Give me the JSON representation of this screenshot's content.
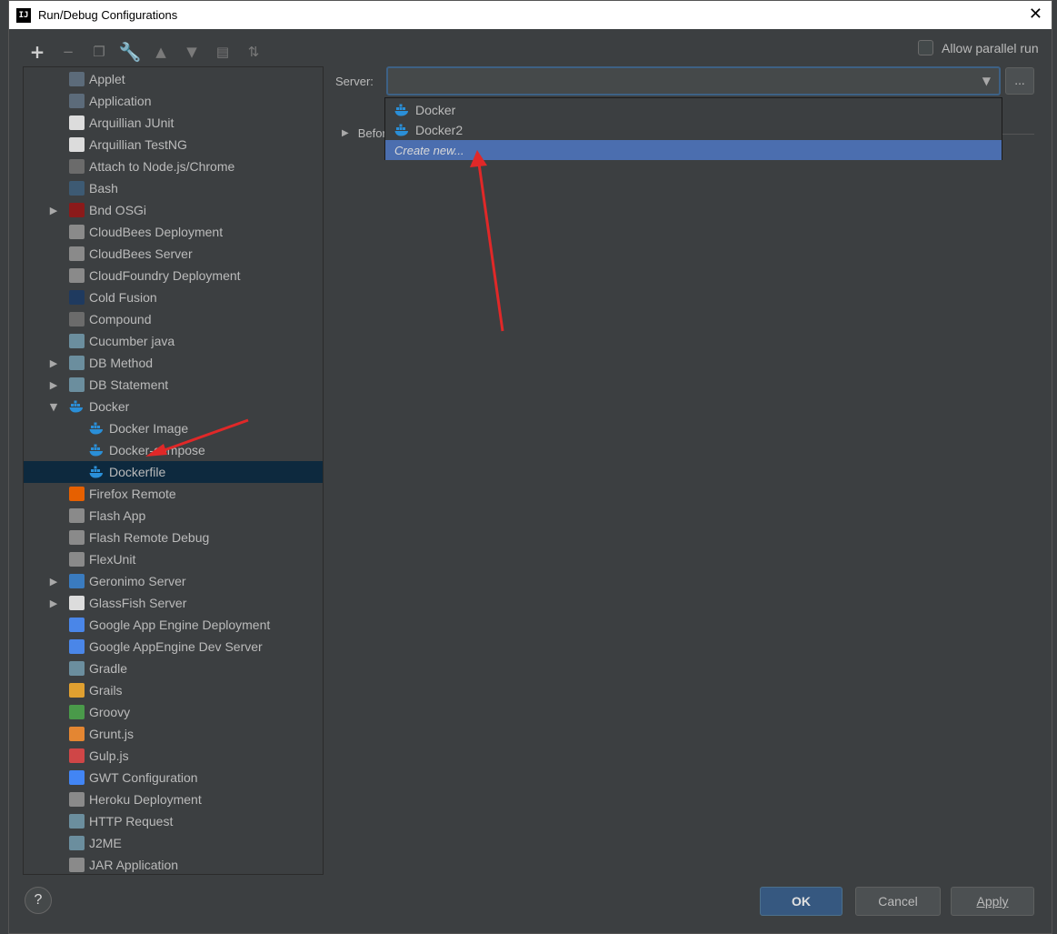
{
  "window": {
    "title": "Run/Debug Configurations",
    "app_icon": "IJ"
  },
  "toolbar": {
    "buttons": [
      {
        "name": "add-icon",
        "glyph": "+",
        "enabled": true
      },
      {
        "name": "remove-icon",
        "glyph": "−",
        "enabled": false
      },
      {
        "name": "copy-icon",
        "glyph": "❐",
        "enabled": false
      },
      {
        "name": "wrench-icon",
        "glyph": "🔧",
        "enabled": true
      },
      {
        "name": "move-up-icon",
        "glyph": "▲",
        "enabled": false
      },
      {
        "name": "move-down-icon",
        "glyph": "▼",
        "enabled": false
      },
      {
        "name": "folder-icon",
        "glyph": "▤",
        "enabled": false
      },
      {
        "name": "sort-icon",
        "glyph": "⇅",
        "enabled": false
      }
    ]
  },
  "allow_parallel": {
    "label": "Allow parallel run",
    "checked": false
  },
  "tree": {
    "items": [
      {
        "label": "Applet",
        "icon": "applet-icon",
        "icon_color": "#5c6b7a",
        "indent": 0,
        "expander": ""
      },
      {
        "label": "Application",
        "icon": "application-icon",
        "icon_color": "#5c6b7a",
        "indent": 0,
        "expander": ""
      },
      {
        "label": "Arquillian JUnit",
        "icon": "arquillian-icon",
        "icon_color": "#dcdcdc",
        "indent": 0,
        "expander": ""
      },
      {
        "label": "Arquillian TestNG",
        "icon": "arquillian-icon",
        "icon_color": "#dcdcdc",
        "indent": 0,
        "expander": ""
      },
      {
        "label": "Attach to Node.js/Chrome",
        "icon": "nodejs-icon",
        "icon_color": "#6b6b6b",
        "indent": 0,
        "expander": ""
      },
      {
        "label": "Bash",
        "icon": "bash-icon",
        "icon_color": "#3d5a73",
        "indent": 0,
        "expander": ""
      },
      {
        "label": "Bnd OSGi",
        "icon": "osgi-icon",
        "icon_color": "#8b1a1a",
        "indent": 0,
        "expander": "right"
      },
      {
        "label": "CloudBees Deployment",
        "icon": "cloudbees-icon",
        "icon_color": "#8a8a8a",
        "indent": 0,
        "expander": ""
      },
      {
        "label": "CloudBees Server",
        "icon": "cloudbees-icon",
        "icon_color": "#8a8a8a",
        "indent": 0,
        "expander": ""
      },
      {
        "label": "CloudFoundry Deployment",
        "icon": "cloudfoundry-icon",
        "icon_color": "#8a8a8a",
        "indent": 0,
        "expander": ""
      },
      {
        "label": "Cold Fusion",
        "icon": "coldfusion-icon",
        "icon_color": "#1f3a5f",
        "indent": 0,
        "expander": ""
      },
      {
        "label": "Compound",
        "icon": "compound-icon",
        "icon_color": "#6b6b6b",
        "indent": 0,
        "expander": ""
      },
      {
        "label": "Cucumber java",
        "icon": "cucumber-icon",
        "icon_color": "#6b8e9e",
        "indent": 0,
        "expander": ""
      },
      {
        "label": "DB Method",
        "icon": "db-method-icon",
        "icon_color": "#6b8e9e",
        "indent": 0,
        "expander": "right"
      },
      {
        "label": "DB Statement",
        "icon": "db-statement-icon",
        "icon_color": "#6b8e9e",
        "indent": 0,
        "expander": "right"
      },
      {
        "label": "Docker",
        "icon": "docker-icon",
        "icon_color": "#2a8fd8",
        "indent": 0,
        "expander": "down"
      },
      {
        "label": "Docker Image",
        "icon": "docker-icon",
        "icon_color": "#2a8fd8",
        "indent": 1,
        "expander": ""
      },
      {
        "label": "Docker-compose",
        "icon": "docker-icon",
        "icon_color": "#2a8fd8",
        "indent": 1,
        "expander": ""
      },
      {
        "label": "Dockerfile",
        "icon": "docker-icon",
        "icon_color": "#2a8fd8",
        "indent": 1,
        "expander": "",
        "selected": true
      },
      {
        "label": "Firefox Remote",
        "icon": "firefox-icon",
        "icon_color": "#e66000",
        "indent": 0,
        "expander": ""
      },
      {
        "label": "Flash App",
        "icon": "flash-icon",
        "icon_color": "#8a8a8a",
        "indent": 0,
        "expander": ""
      },
      {
        "label": "Flash Remote Debug",
        "icon": "flash-icon",
        "icon_color": "#8a8a8a",
        "indent": 0,
        "expander": ""
      },
      {
        "label": "FlexUnit",
        "icon": "flexunit-icon",
        "icon_color": "#8a8a8a",
        "indent": 0,
        "expander": ""
      },
      {
        "label": "Geronimo Server",
        "icon": "geronimo-icon",
        "icon_color": "#3a7bbf",
        "indent": 0,
        "expander": "right"
      },
      {
        "label": "GlassFish Server",
        "icon": "glassfish-icon",
        "icon_color": "#dcdcdc",
        "indent": 0,
        "expander": "right"
      },
      {
        "label": "Google App Engine Deployment",
        "icon": "app-engine-icon",
        "icon_color": "#4a86e8",
        "indent": 0,
        "expander": ""
      },
      {
        "label": "Google AppEngine Dev Server",
        "icon": "app-engine-icon",
        "icon_color": "#4a86e8",
        "indent": 0,
        "expander": ""
      },
      {
        "label": "Gradle",
        "icon": "gradle-icon",
        "icon_color": "#6b8e9e",
        "indent": 0,
        "expander": ""
      },
      {
        "label": "Grails",
        "icon": "grails-icon",
        "icon_color": "#e0a030",
        "indent": 0,
        "expander": ""
      },
      {
        "label": "Groovy",
        "icon": "groovy-icon",
        "icon_color": "#4a9a4a",
        "indent": 0,
        "expander": ""
      },
      {
        "label": "Grunt.js",
        "icon": "grunt-icon",
        "icon_color": "#e48632",
        "indent": 0,
        "expander": ""
      },
      {
        "label": "Gulp.js",
        "icon": "gulp-icon",
        "icon_color": "#cf4647",
        "indent": 0,
        "expander": ""
      },
      {
        "label": "GWT Configuration",
        "icon": "google-icon",
        "icon_color": "#4285f4",
        "indent": 0,
        "expander": ""
      },
      {
        "label": "Heroku Deployment",
        "icon": "heroku-icon",
        "icon_color": "#8a8a8a",
        "indent": 0,
        "expander": ""
      },
      {
        "label": "HTTP Request",
        "icon": "http-request-icon",
        "icon_color": "#6b8e9e",
        "indent": 0,
        "expander": ""
      },
      {
        "label": "J2ME",
        "icon": "j2me-icon",
        "icon_color": "#6b8e9e",
        "indent": 0,
        "expander": ""
      },
      {
        "label": "JAR Application",
        "icon": "jar-icon",
        "icon_color": "#8a8a8a",
        "indent": 0,
        "expander": ""
      }
    ]
  },
  "server": {
    "label": "Server:",
    "value": "",
    "browse_label": "..."
  },
  "before_launch": {
    "label": "Befor"
  },
  "dropdown": {
    "options": [
      {
        "label": "Docker",
        "icon": "docker-icon"
      },
      {
        "label": "Docker2",
        "icon": "docker-icon"
      }
    ],
    "create_new": "Create new..."
  },
  "buttons": {
    "ok": "OK",
    "cancel": "Cancel",
    "apply": "Apply",
    "help": "?"
  }
}
